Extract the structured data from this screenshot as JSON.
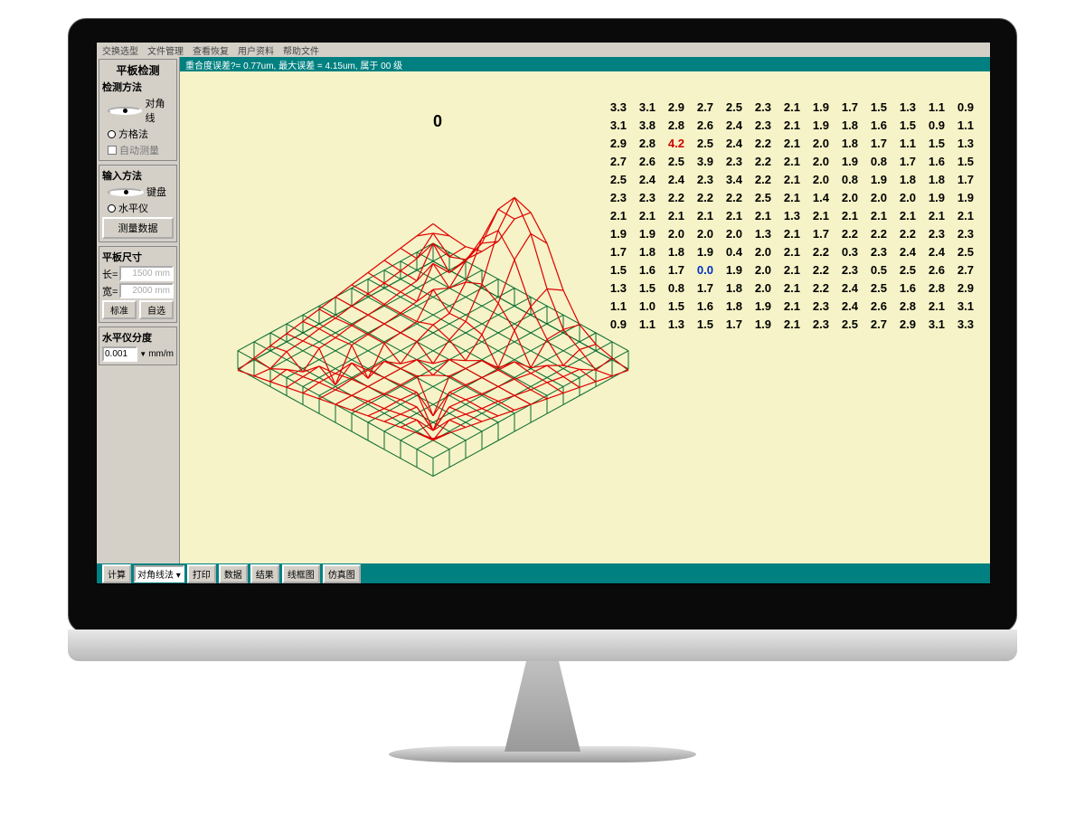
{
  "menu": {
    "items": [
      "交换选型",
      "文件管理",
      "查看恢复",
      "用户资料",
      "帮助文件"
    ]
  },
  "status_line": "重合度误差?= 0.77um, 最大误差 = 4.15um, 属于 00  级",
  "sidebar": {
    "title": "平板检测",
    "method_section": "检测方法",
    "method_diag": "对角线",
    "method_grid": "方格法",
    "auto_measure": "自动测量",
    "input_section": "输入方法",
    "input_kb": "键盘",
    "input_level": "水平仪",
    "btn_measure": "测量数据",
    "size_section": "平板尺寸",
    "length_label": "长=",
    "length_val": "1500 mm",
    "width_label": "宽=",
    "width_val": "2000 mm",
    "btn_standard": "标准",
    "btn_custom": "自选",
    "resolution_section": "水平仪分度",
    "resolution_val": "0.001",
    "resolution_unit": "mm/m"
  },
  "apex_label": "0",
  "chart_data": {
    "type": "heatmap",
    "title": "平板平面度 3D 网格 / 误差数值 (μm)",
    "xlabel": "",
    "ylabel": "",
    "max_value": 4.2,
    "min_value": 0.0,
    "rows": [
      [
        3.3,
        3.1,
        2.9,
        2.7,
        2.5,
        2.3,
        2.1,
        1.9,
        1.7,
        1.5,
        1.3,
        1.1,
        0.9
      ],
      [
        3.1,
        3.8,
        2.8,
        2.6,
        2.4,
        2.3,
        2.1,
        1.9,
        1.8,
        1.6,
        1.5,
        0.9,
        1.1
      ],
      [
        2.9,
        2.8,
        4.2,
        2.5,
        2.4,
        2.2,
        2.1,
        2.0,
        1.8,
        1.7,
        1.1,
        1.5,
        1.3
      ],
      [
        2.7,
        2.6,
        2.5,
        3.9,
        2.3,
        2.2,
        2.1,
        2.0,
        1.9,
        0.8,
        1.7,
        1.6,
        1.5
      ],
      [
        2.5,
        2.4,
        2.4,
        2.3,
        3.4,
        2.2,
        2.1,
        2.0,
        0.8,
        1.9,
        1.8,
        1.8,
        1.7
      ],
      [
        2.3,
        2.3,
        2.2,
        2.2,
        2.2,
        2.5,
        2.1,
        1.4,
        2.0,
        2.0,
        2.0,
        1.9,
        1.9
      ],
      [
        2.1,
        2.1,
        2.1,
        2.1,
        2.1,
        2.1,
        1.3,
        2.1,
        2.1,
        2.1,
        2.1,
        2.1,
        2.1
      ],
      [
        1.9,
        1.9,
        2.0,
        2.0,
        2.0,
        1.3,
        2.1,
        1.7,
        2.2,
        2.2,
        2.2,
        2.3,
        2.3
      ],
      [
        1.7,
        1.8,
        1.8,
        1.9,
        0.4,
        2.0,
        2.1,
        2.2,
        0.3,
        2.3,
        2.4,
        2.4,
        2.5
      ],
      [
        1.5,
        1.6,
        1.7,
        0.0,
        1.9,
        2.0,
        2.1,
        2.2,
        2.3,
        0.5,
        2.5,
        2.6,
        2.7
      ],
      [
        1.3,
        1.5,
        0.8,
        1.7,
        1.8,
        2.0,
        2.1,
        2.2,
        2.4,
        2.5,
        1.6,
        2.8,
        2.9
      ],
      [
        1.1,
        1.0,
        1.5,
        1.6,
        1.8,
        1.9,
        2.1,
        2.3,
        2.4,
        2.6,
        2.8,
        2.1,
        3.1
      ],
      [
        0.9,
        1.1,
        1.3,
        1.5,
        1.7,
        1.9,
        2.1,
        2.3,
        2.5,
        2.7,
        2.9,
        3.1,
        3.3
      ]
    ]
  },
  "bottom_buttons": {
    "calc": "计算",
    "method_sel": "对角线法",
    "print": "打印",
    "data": "数据",
    "result": "结果",
    "lineplot": "线框图",
    "sim": "仿真图"
  }
}
